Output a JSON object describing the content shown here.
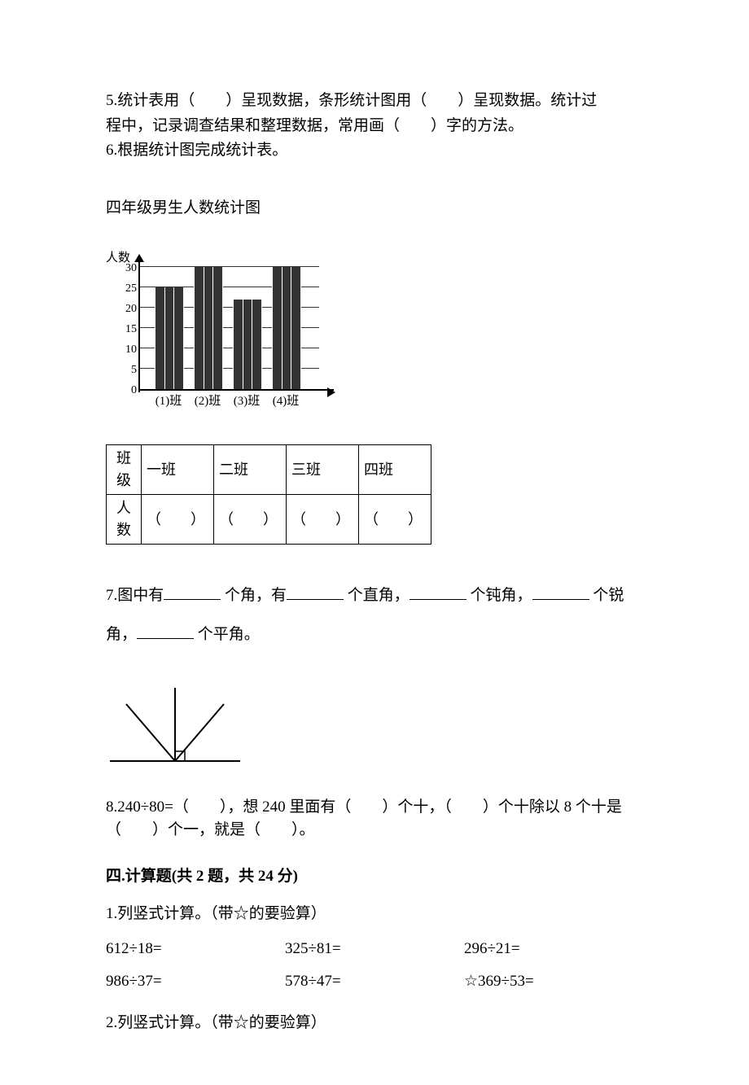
{
  "q5": {
    "text_a": "5.统计表用（　　）呈现数据，条形统计图用（　　）呈现数据。统计过",
    "text_b": "程中，记录调查结果和整理数据，常用画（　　）字的方法。"
  },
  "q6": {
    "text": "6.根据统计图完成统计表。"
  },
  "chart_title": "四年级男生人数统计图",
  "chart_data": {
    "type": "bar",
    "ylabel": "人数",
    "ylim": [
      0,
      30
    ],
    "ticks": [
      0,
      5,
      10,
      15,
      20,
      25,
      30
    ],
    "categories": [
      "(1)班",
      "(2)班",
      "(3)班",
      "(4)班"
    ],
    "values": [
      25,
      30,
      22,
      30
    ]
  },
  "table": {
    "row1": {
      "h": "班级",
      "c1": "一班",
      "c2": "二班",
      "c3": "三班",
      "c4": "四班"
    },
    "row2": {
      "h": "人数",
      "c1": "（　　）",
      "c2": "（　　）",
      "c3": "（　　）",
      "c4": "（　　）"
    }
  },
  "q7": {
    "line1_a": "7.图中有",
    "line1_b": "个角，有",
    "line1_c": "个直角，",
    "line1_d": "个钝角，",
    "line1_e": "个锐",
    "line2_a": "角，",
    "line2_b": "个平角。"
  },
  "q8": {
    "text": "8.240÷80=（　　），想 240 里面有（　　）个十，（　　）个十除以 8 个十是（　　）个一，就是（　　）。"
  },
  "section4": {
    "title": "四.计算题(共 2 题，共 24 分)"
  },
  "p1": {
    "title": "1.列竖式计算。（带☆的要验算）",
    "r1c1": "612÷18=",
    "r1c2": "325÷81=",
    "r1c3": "296÷21=",
    "r2c1": "986÷37=",
    "r2c2": "578÷47=",
    "r2c3": "☆369÷53="
  },
  "p2": {
    "title": "2.列竖式计算。（带☆的要验算）"
  }
}
